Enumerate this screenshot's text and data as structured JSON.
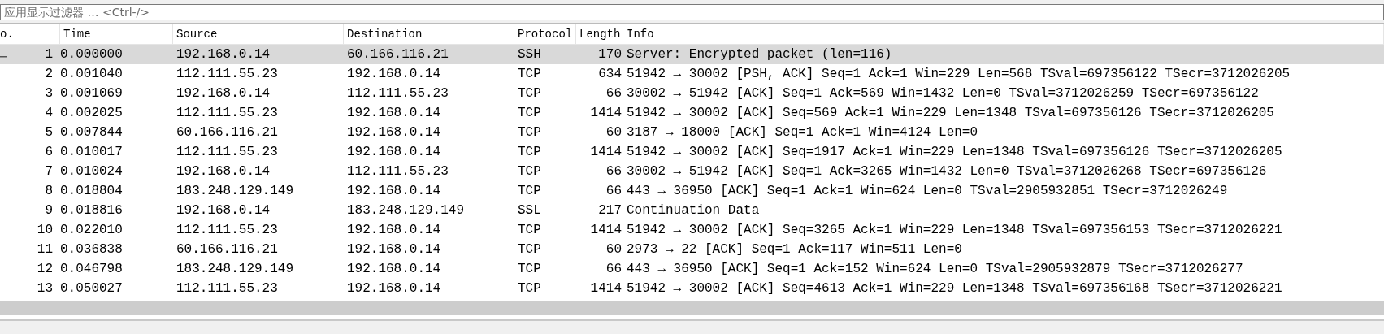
{
  "filter": {
    "placeholder": "应用显示过滤器 … <Ctrl-/>"
  },
  "table": {
    "columns": [
      "o.",
      "Time",
      "Source",
      "Destination",
      "Protocol",
      "Length",
      "Info"
    ],
    "rows": [
      {
        "no": "1",
        "time": "0.000000",
        "source": "192.168.0.14",
        "destination": "60.166.116.21",
        "protocol": "SSH",
        "length": "170",
        "info": "Server: Encrypted packet (len=116)",
        "selected": true
      },
      {
        "no": "2",
        "time": "0.001040",
        "source": "112.111.55.23",
        "destination": "192.168.0.14",
        "protocol": "TCP",
        "length": "634",
        "info": "51942 → 30002 [PSH, ACK] Seq=1 Ack=1 Win=229 Len=568 TSval=697356122 TSecr=3712026205",
        "selected": false
      },
      {
        "no": "3",
        "time": "0.001069",
        "source": "192.168.0.14",
        "destination": "112.111.55.23",
        "protocol": "TCP",
        "length": "66",
        "info": "30002 → 51942 [ACK] Seq=1 Ack=569 Win=1432 Len=0 TSval=3712026259 TSecr=697356122",
        "selected": false
      },
      {
        "no": "4",
        "time": "0.002025",
        "source": "112.111.55.23",
        "destination": "192.168.0.14",
        "protocol": "TCP",
        "length": "1414",
        "info": "51942 → 30002 [ACK] Seq=569 Ack=1 Win=229 Len=1348 TSval=697356126 TSecr=3712026205",
        "selected": false
      },
      {
        "no": "5",
        "time": "0.007844",
        "source": "60.166.116.21",
        "destination": "192.168.0.14",
        "protocol": "TCP",
        "length": "60",
        "info": "3187 → 18000 [ACK] Seq=1 Ack=1 Win=4124 Len=0",
        "selected": false
      },
      {
        "no": "6",
        "time": "0.010017",
        "source": "112.111.55.23",
        "destination": "192.168.0.14",
        "protocol": "TCP",
        "length": "1414",
        "info": "51942 → 30002 [ACK] Seq=1917 Ack=1 Win=229 Len=1348 TSval=697356126 TSecr=3712026205",
        "selected": false
      },
      {
        "no": "7",
        "time": "0.010024",
        "source": "192.168.0.14",
        "destination": "112.111.55.23",
        "protocol": "TCP",
        "length": "66",
        "info": "30002 → 51942 [ACK] Seq=1 Ack=3265 Win=1432 Len=0 TSval=3712026268 TSecr=697356126",
        "selected": false
      },
      {
        "no": "8",
        "time": "0.018804",
        "source": "183.248.129.149",
        "destination": "192.168.0.14",
        "protocol": "TCP",
        "length": "66",
        "info": "443 → 36950 [ACK] Seq=1 Ack=1 Win=624 Len=0 TSval=2905932851 TSecr=3712026249",
        "selected": false
      },
      {
        "no": "9",
        "time": "0.018816",
        "source": "192.168.0.14",
        "destination": "183.248.129.149",
        "protocol": "SSL",
        "length": "217",
        "info": "Continuation Data",
        "selected": false
      },
      {
        "no": "10",
        "time": "0.022010",
        "source": "112.111.55.23",
        "destination": "192.168.0.14",
        "protocol": "TCP",
        "length": "1414",
        "info": "51942 → 30002 [ACK] Seq=3265 Ack=1 Win=229 Len=1348 TSval=697356153 TSecr=3712026221",
        "selected": false
      },
      {
        "no": "11",
        "time": "0.036838",
        "source": "60.166.116.21",
        "destination": "192.168.0.14",
        "protocol": "TCP",
        "length": "60",
        "info": "2973 → 22 [ACK] Seq=1 Ack=117 Win=511 Len=0",
        "selected": false
      },
      {
        "no": "12",
        "time": "0.046798",
        "source": "183.248.129.149",
        "destination": "192.168.0.14",
        "protocol": "TCP",
        "length": "66",
        "info": "443 → 36950 [ACK] Seq=1 Ack=152 Win=624 Len=0 TSval=2905932879 TSecr=3712026277",
        "selected": false
      },
      {
        "no": "13",
        "time": "0.050027",
        "source": "112.111.55.23",
        "destination": "192.168.0.14",
        "protocol": "TCP",
        "length": "1414",
        "info": "51942 → 30002 [ACK] Seq=4613 Ack=1 Win=229 Len=1348 TSval=697356168 TSecr=3712026221",
        "selected": false
      }
    ]
  }
}
